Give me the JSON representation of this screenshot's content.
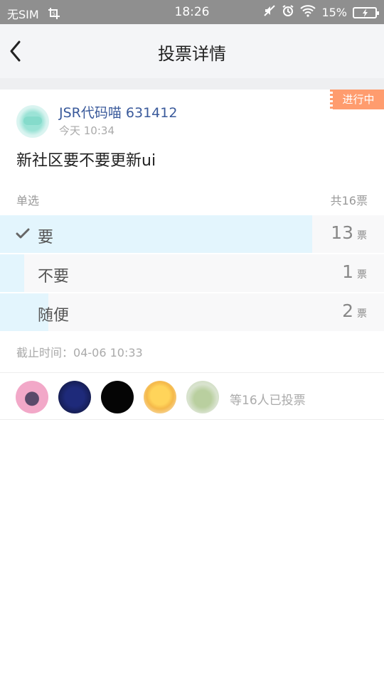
{
  "status_bar": {
    "carrier": "无SIM",
    "time": "18:26",
    "battery": "15%"
  },
  "header": {
    "title": "投票详情"
  },
  "post": {
    "status_badge": "进行中",
    "author": "JSR代码喵 631412",
    "time": "今天 10:34",
    "question": "新社区要不要更新ui"
  },
  "vote": {
    "type": "单选",
    "total": "共16票",
    "unit": "票",
    "options": [
      {
        "label": "要",
        "count": "13",
        "selected": true,
        "fraction": 0.8125
      },
      {
        "label": "不要",
        "count": "1",
        "selected": false,
        "fraction": 0.0625
      },
      {
        "label": "随便",
        "count": "2",
        "selected": false,
        "fraction": 0.125
      }
    ],
    "deadline_label": "截止时间：",
    "deadline_value": "04-06 10:33"
  },
  "voters": {
    "summary": "等16人已投票"
  },
  "colors": {
    "accent_blue": "#3a5a9b",
    "badge_orange": "#ff9c6e",
    "bar_fill": "#e3f5fd"
  }
}
